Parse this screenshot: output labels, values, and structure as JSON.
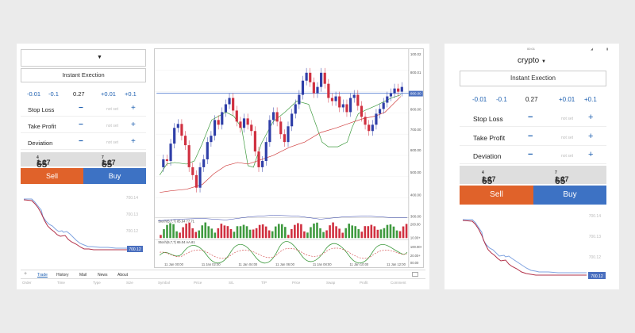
{
  "desktop": {
    "instrument": "",
    "instant_execution": "Instant Exection",
    "prices": {
      "minus1": "-0.01",
      "minus2": "-0.1",
      "volume": "0.27",
      "plus1": "+0.01",
      "plus2": "+0.1"
    },
    "rows": [
      {
        "label": "Stop Loss",
        "placeholder": "not set"
      },
      {
        "label": "Take Profit",
        "placeholder": "not set"
      },
      {
        "label": "Deviation",
        "placeholder": "not set"
      }
    ],
    "bid": {
      "main": "1.27",
      "big": "65",
      "sup": "4"
    },
    "ask": {
      "main": "1.27",
      "big": "65",
      "sup": "7"
    },
    "sell": "Sell",
    "buy": "Buy",
    "mini_labels": [
      "700.14",
      "700.13",
      "700.12",
      "700.12"
    ],
    "tabs": [
      "Trade",
      "History",
      "Mail",
      "News",
      "About"
    ],
    "columns": [
      "Order",
      "Time",
      "Type",
      "Size",
      "Symbol",
      "Price",
      "S/L",
      "T/P",
      "Price",
      "Swap",
      "Profit",
      "Comment"
    ]
  },
  "chart": {
    "y_ticks": [
      "100.02",
      "800.01",
      "800.00",
      "700.00",
      "600.00",
      "500.00",
      "400.00",
      "300.00"
    ],
    "price_label": "800.00",
    "stoch1_label": "Stoch(5,7,7) 85.64 77.71",
    "stoch1_ticks": [
      "200.00",
      "10.00+"
    ],
    "stoch2_label": "Stoch(5,7,7) 65.04 AA.81",
    "stoch2_ticks": [
      "100.00+",
      "20.00+",
      "00.00"
    ],
    "x_ticks": [
      "11 Jan 00:00",
      "11 Jan 02:00",
      "11 Jan 04:00",
      "11 Jan 06:00",
      "11 Jan 08:00",
      "11 Jan 10:00",
      "11 Jan 12:00"
    ],
    "colors": {
      "bull": "#2f3fa8",
      "bear": "#d03040",
      "ma_green": "#3f9a3f",
      "ma_red": "#d04040",
      "hline": "#6b8fd8"
    }
  },
  "mobile": {
    "status_time": "00:01",
    "title": "crypto",
    "instant_execution": "Instant Exection",
    "prices": {
      "minus1": "-0.01",
      "minus2": "-0.1",
      "volume": "0.27",
      "plus1": "+0.01",
      "plus2": "+0.1"
    },
    "rows": [
      {
        "label": "Stop Loss",
        "placeholder": "not set"
      },
      {
        "label": "Take Profit",
        "placeholder": "not set"
      },
      {
        "label": "Deviation",
        "placeholder": "not set"
      }
    ],
    "bid": {
      "main": "1.27",
      "big": "65",
      "sup": "4"
    },
    "ask": {
      "main": "1.27",
      "big": "65",
      "sup": "7"
    },
    "sell": "Sell",
    "buy": "Buy",
    "mini_labels": [
      "700.14",
      "700.13",
      "700.12",
      "700.12"
    ]
  }
}
